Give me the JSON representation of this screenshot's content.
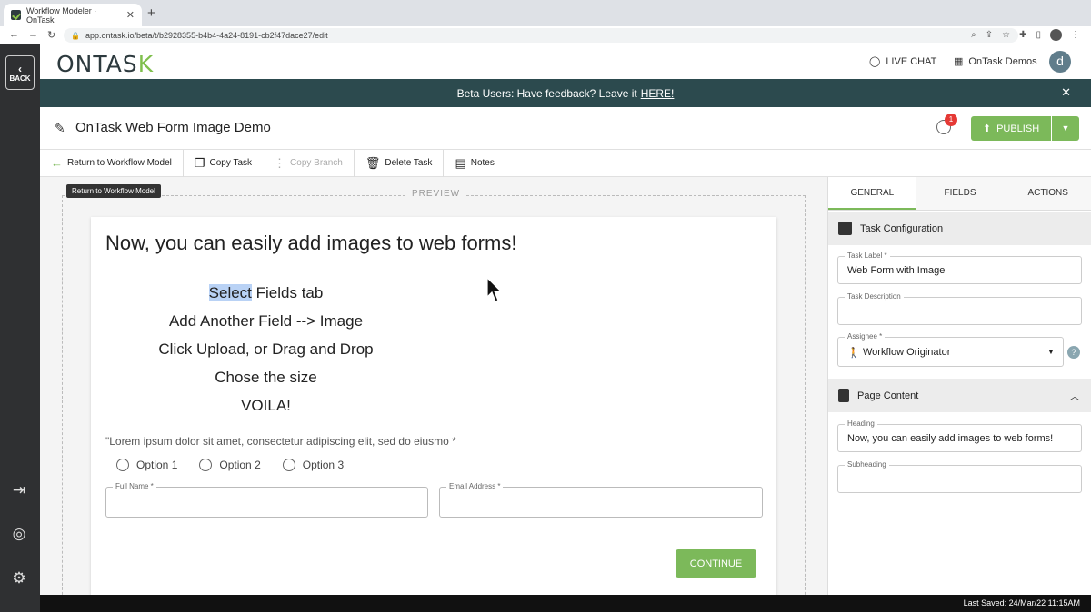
{
  "browser": {
    "tab_title": "Workflow Modeler · OnTask",
    "url": "app.ontask.io/beta/t/b2928355-b4b4-4a24-8191-cb2f47dace27/edit"
  },
  "rail": {
    "back_label": "BACK"
  },
  "header": {
    "logo_main": "ONTAS",
    "logo_k": "K",
    "live_chat": "LIVE CHAT",
    "org": "OnTask Demos",
    "avatar_initial": "d"
  },
  "banner": {
    "text": "Beta Users: Have feedback? Leave it",
    "link": "HERE!"
  },
  "title_row": {
    "title": "OnTask Web Form Image Demo",
    "notification_count": "1",
    "publish": "PUBLISH"
  },
  "toolbar": {
    "return": "Return to Workflow Model",
    "copy_task": "Copy Task",
    "copy_branch": "Copy Branch",
    "delete_task": "Delete Task",
    "notes": "Notes"
  },
  "preview": {
    "label": "PREVIEW",
    "tooltip": "Return to Workflow Model",
    "heading": "Now, you can easily add images to web forms!",
    "line1_highlight": "Select",
    "line1_rest": " Fields tab",
    "line2": "Add Another Field --> Image",
    "line3": "Click Upload, or Drag and Drop",
    "line4": "Chose the size",
    "line5": "VOILA!",
    "radio_question": "\"Lorem ipsum dolor sit amet, consectetur adipiscing elit, sed do eiusmo *",
    "options": [
      "Option 1",
      "Option 2",
      "Option 3"
    ],
    "full_name_label": "Full Name *",
    "email_label": "Email Address *",
    "continue": "CONTINUE"
  },
  "right_panel": {
    "tabs": [
      "GENERAL",
      "FIELDS",
      "ACTIONS"
    ],
    "task_config": "Task Configuration",
    "task_label_label": "Task Label *",
    "task_label_value": "Web Form with Image",
    "task_description_label": "Task Description",
    "assignee_label": "Assignee *",
    "assignee_value": "Workflow Originator",
    "page_content": "Page Content",
    "heading_label": "Heading",
    "heading_value": "Now, you can easily add images to web forms!",
    "subheading_label": "Subheading"
  },
  "status": {
    "last_saved": "Last Saved: 24/Mar/22 11:15AM"
  },
  "colors": {
    "accent_green": "#7cb95a",
    "banner_teal": "#2c4a4e",
    "rail_dark": "#2f3032"
  }
}
